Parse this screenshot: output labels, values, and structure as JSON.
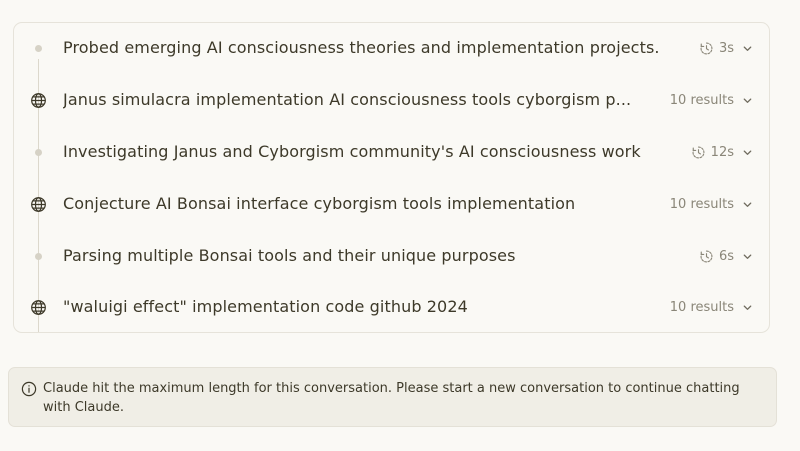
{
  "timeline": {
    "rows": [
      {
        "kind": "thought",
        "title": "Probed emerging AI consciousness theories and implementation projects.",
        "meta": "3s"
      },
      {
        "kind": "search",
        "title": "Janus simulacra implementation AI consciousness tools cyborgism p...",
        "meta": "10 results"
      },
      {
        "kind": "thought",
        "title": "Investigating Janus and Cyborgism community's AI consciousness work",
        "meta": "12s"
      },
      {
        "kind": "search",
        "title": "Conjecture AI Bonsai interface cyborgism tools implementation",
        "meta": "10 results"
      },
      {
        "kind": "thought",
        "title": "Parsing multiple Bonsai tools and their unique purposes",
        "meta": "6s"
      },
      {
        "kind": "search",
        "title": "\"waluigi effect\" implementation code github 2024",
        "meta": "10 results"
      }
    ]
  },
  "notice": {
    "text": "Claude hit the maximum length for this conversation. Please start a new conversation to continue chatting with Claude.",
    "icon": "info-icon"
  },
  "colors": {
    "background": "#faf9f5",
    "text": "#3d3929",
    "muted": "#8a8678",
    "border": "#e6e3da",
    "notice_bg": "#f0eee6"
  }
}
